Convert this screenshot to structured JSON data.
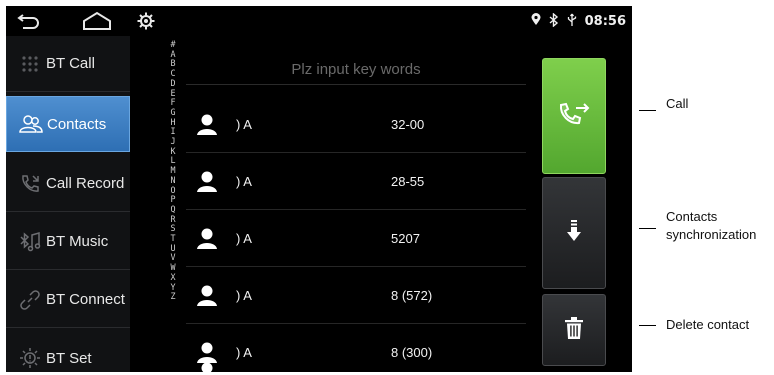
{
  "status_bar": {
    "icons": [
      "back-icon",
      "home-icon",
      "settings-icon",
      "location-icon",
      "bluetooth-icon",
      "usb-icon"
    ],
    "time": "08:56"
  },
  "sidebar": {
    "items": [
      {
        "label": "BT Call",
        "icon": "dialpad-icon",
        "active": false
      },
      {
        "label": "Contacts",
        "icon": "contacts-icon",
        "active": true
      },
      {
        "label": "Call Record",
        "icon": "call-record-icon",
        "active": false
      },
      {
        "label": "BT Music",
        "icon": "music-icon",
        "active": false
      },
      {
        "label": "BT Connect",
        "icon": "link-icon",
        "active": false
      },
      {
        "label": "BT Set",
        "icon": "gear-icon",
        "active": false
      }
    ]
  },
  "index_letters": [
    "#",
    "A",
    "B",
    "C",
    "D",
    "E",
    "F",
    "G",
    "H",
    "I",
    "J",
    "K",
    "L",
    "M",
    "N",
    "O",
    "P",
    "Q",
    "R",
    "S",
    "T",
    "U",
    "V",
    "W",
    "X",
    "Y",
    "Z"
  ],
  "search": {
    "placeholder": "Plz input key words"
  },
  "contacts": [
    {
      "name": ") A",
      "number": "32-00"
    },
    {
      "name": ") A",
      "number": "28-55"
    },
    {
      "name": ") A",
      "number": "5207"
    },
    {
      "name": ") A",
      "number": "8 (572)"
    },
    {
      "name": ") A",
      "number": "8 (300)"
    }
  ],
  "buttons": {
    "call": {
      "icon": "phone-arrow-icon",
      "color": "#6abf3f"
    },
    "sync": {
      "icon": "download-arrow-icon"
    },
    "delete": {
      "icon": "trash-icon"
    }
  },
  "annotations": {
    "call": "Call",
    "sync_line1": "Contacts",
    "sync_line2": "synchronization",
    "delete": "Delete contact"
  }
}
